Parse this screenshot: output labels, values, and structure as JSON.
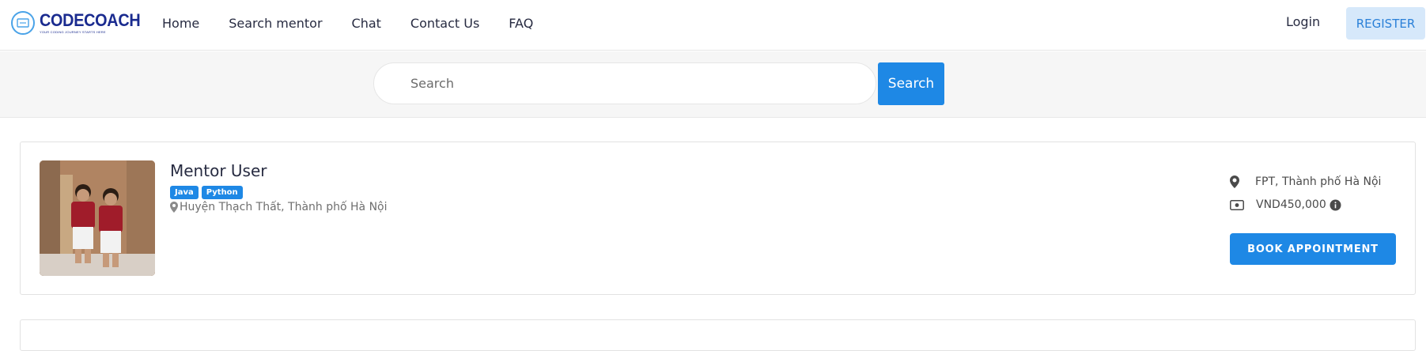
{
  "brand": {
    "name": "CODECOACH",
    "tagline": "YOUR CODING JOURNEY STARTS HERE"
  },
  "nav": {
    "items": [
      "Home",
      "Search mentor",
      "Chat",
      "Contact Us",
      "FAQ"
    ]
  },
  "auth": {
    "login_label": "Login",
    "register_label": "REGISTER"
  },
  "search": {
    "placeholder": "Search",
    "button_label": "Search"
  },
  "mentor": {
    "name": "Mentor User",
    "tags": [
      "Java",
      "Python"
    ],
    "location": "Huyện Thạch Thất, Thành phố Hà Nội",
    "workplace": "FPT, Thành phố Hà Nội",
    "price": "VND450,000",
    "book_label": "BOOK APPOINTMENT"
  },
  "colors": {
    "accent": "#1e88e5",
    "brand": "#1a2b8f",
    "register_bg": "#d6e8fa"
  }
}
